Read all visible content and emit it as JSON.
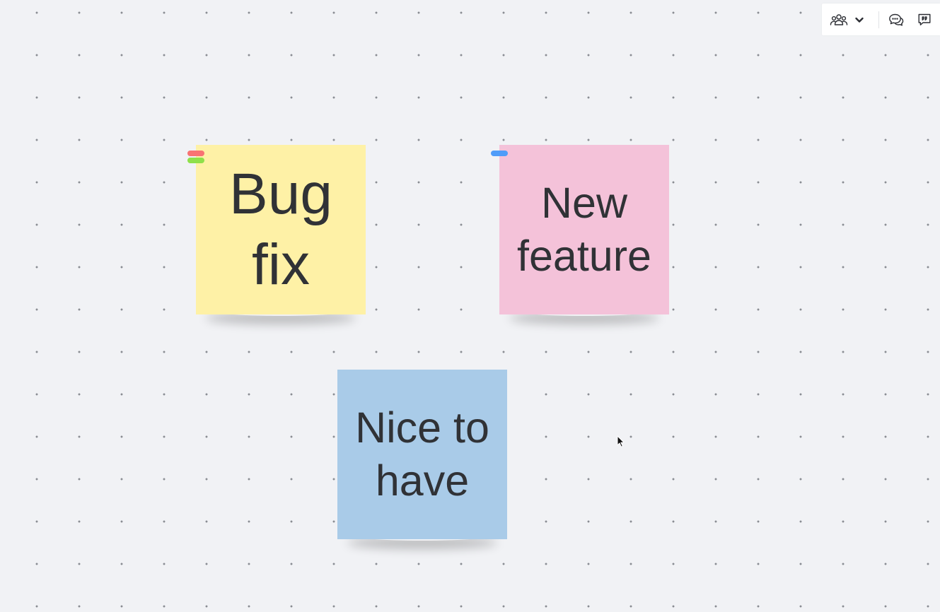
{
  "canvas": {
    "background": "#f1f2f5",
    "grid_dot_color": "#8a8d93"
  },
  "toolbar": {
    "collaborators_icon": "users-group-icon",
    "collaborators_menu_icon": "chevron-down-icon",
    "comments_icon": "comments-icon",
    "feedback_icon": "feedback-quote-icon"
  },
  "sticky_notes": [
    {
      "text": "Bug fix",
      "line1": "Bug",
      "line2": "fix",
      "color": "#fef1a6",
      "tags": [
        "#f87373",
        "#8fe04a"
      ]
    },
    {
      "text": "New feature",
      "line1": "New",
      "line2": "feature",
      "color": "#f4c2d9",
      "tags": [
        "#4f9cf9"
      ]
    },
    {
      "text": "Nice to have",
      "line1": "Nice to",
      "line2": "have",
      "color": "#a9cbe8",
      "tags": []
    }
  ],
  "cursor_icon": "mouse-pointer-icon"
}
